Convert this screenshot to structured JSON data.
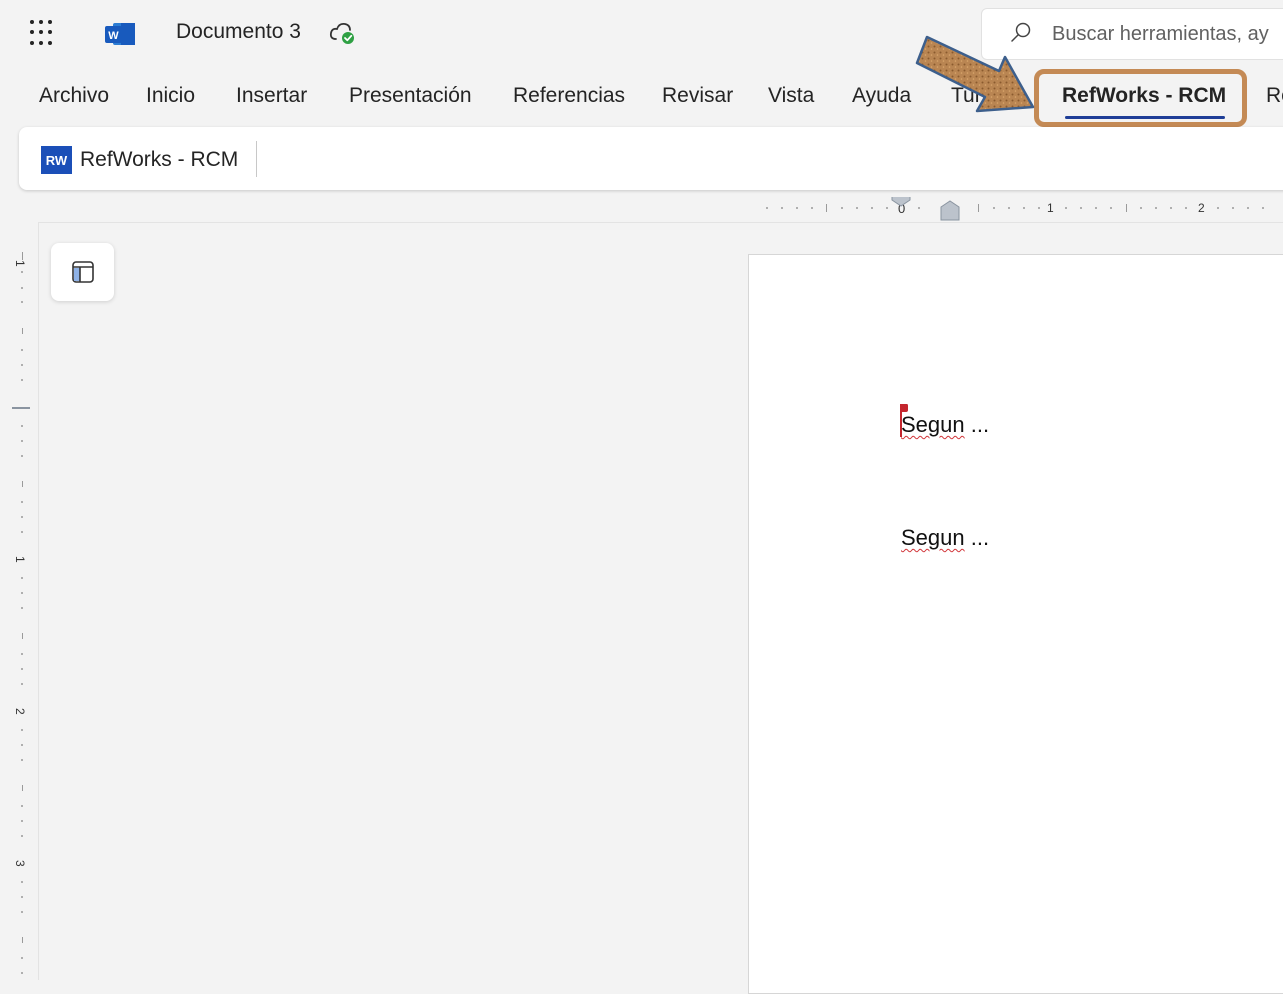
{
  "titlebar": {
    "app_icon": "word-icon",
    "word_letter": "W",
    "document_title": "Documento 3",
    "save_status_icon": "cloud-saved-icon",
    "search_placeholder": "Buscar herramientas, ay"
  },
  "tabs": [
    {
      "label": "Archivo"
    },
    {
      "label": "Inicio"
    },
    {
      "label": "Insertar"
    },
    {
      "label": "Presentación"
    },
    {
      "label": "Referencias"
    },
    {
      "label": "Revisar"
    },
    {
      "label": "Vista"
    },
    {
      "label": "Ayuda"
    },
    {
      "label": "Turnitin"
    },
    {
      "label": "RefWorks - RCM"
    },
    {
      "label": "Re"
    }
  ],
  "active_tab": "RefWorks - RCM",
  "ribbon": {
    "badge": "RW",
    "label": "RefWorks - RCM"
  },
  "ruler": {
    "horizontal_marks": [
      "0",
      "1",
      "2"
    ],
    "vertical_marks": [
      "1",
      "1",
      "2",
      "3"
    ]
  },
  "document": {
    "paragraphs": [
      {
        "word": "Segun",
        "rest": " ..."
      },
      {
        "word": "Segun",
        "rest": " ..."
      }
    ]
  },
  "colors": {
    "accent": "#1f3e97",
    "highlight_box": "#c48a55",
    "badge_blue": "#1b4fb8",
    "spell_error": "#d13438"
  }
}
